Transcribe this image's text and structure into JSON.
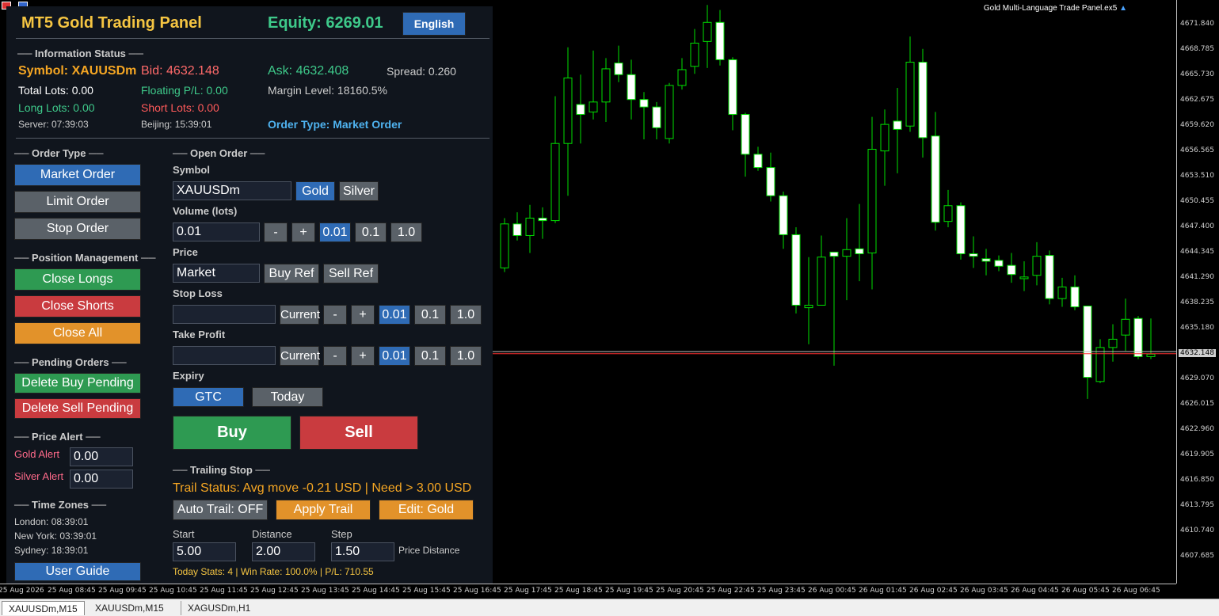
{
  "window": {
    "chart_title": "Gold Multi-Language Trade Panel.ex5",
    "tabs": [
      "XAUUSDm,M15",
      "XAUUSDm,M15",
      "XAGUSDm,H1"
    ],
    "active_tab": 0
  },
  "colors": {
    "bull_candle": "#00e000",
    "bear_candle_fill": "#ffffff",
    "bid_line": "#ff3030",
    "ask_line": "#c0c0c0",
    "panel_bg": "#10151d",
    "title_gold": "#f5c542",
    "equity_green": "#3ec98a"
  },
  "price_axis": {
    "labels": [
      "4671.840",
      "4668.785",
      "4665.730",
      "4662.675",
      "4659.620",
      "4656.565",
      "4653.510",
      "4650.455",
      "4647.400",
      "4644.345",
      "4641.290",
      "4638.235",
      "4635.180",
      "4629.070",
      "4626.015",
      "4622.960",
      "4619.905",
      "4616.850",
      "4613.795",
      "4610.740",
      "4607.685"
    ],
    "current_price_label": "4632.148"
  },
  "time_axis": {
    "labels": [
      "25 Aug 2026",
      "25 Aug 08:45",
      "25 Aug 09:45",
      "25 Aug 10:45",
      "25 Aug 11:45",
      "25 Aug 12:45",
      "25 Aug 13:45",
      "25 Aug 14:45",
      "25 Aug 15:45",
      "25 Aug 16:45",
      "25 Aug 17:45",
      "25 Aug 18:45",
      "25 Aug 19:45",
      "25 Aug 20:45",
      "25 Aug 22:45",
      "25 Aug 23:45",
      "26 Aug 00:45",
      "26 Aug 01:45",
      "26 Aug 02:45",
      "26 Aug 03:45",
      "26 Aug 04:45",
      "26 Aug 05:45",
      "26 Aug 06:45"
    ]
  },
  "candles": [
    [
      4642.5,
      4647.8,
      4642.0,
      4648.5
    ],
    [
      4647.8,
      4646.4,
      4645.8,
      4649.2
    ],
    [
      4646.4,
      4648.5,
      4644.3,
      4650.1
    ],
    [
      4648.5,
      4648.2,
      4646.0,
      4649.8
    ],
    [
      4648.2,
      4657.5,
      4647.9,
      4663.2
    ],
    [
      4657.5,
      4665.4,
      4651.2,
      4669.1
    ],
    [
      4662.2,
      4661.0,
      4657.5,
      4665.8
    ],
    [
      4661.3,
      4662.5,
      4660.4,
      4668.7
    ],
    [
      4662.5,
      4666.5,
      4660.1,
      4667.8
    ],
    [
      4667.2,
      4665.8,
      4664.9,
      4669.3
    ],
    [
      4665.8,
      4662.8,
      4660.4,
      4667.6
    ],
    [
      4662.8,
      4661.9,
      4658.0,
      4663.7
    ],
    [
      4661.9,
      4659.4,
      4658.0,
      4662.5
    ],
    [
      4658.1,
      4664.5,
      4657.5,
      4664.8
    ],
    [
      4664.5,
      4666.4,
      4664.0,
      4667.8
    ],
    [
      4666.8,
      4669.6,
      4665.9,
      4671.3
    ],
    [
      4669.8,
      4672.1,
      4666.6,
      4674.2
    ],
    [
      4672.1,
      4667.6,
      4666.9,
      4673.6
    ],
    [
      4667.6,
      4661.0,
      4659.1,
      4667.9
    ],
    [
      4661.0,
      4656.2,
      4653.5,
      4661.2
    ],
    [
      4656.2,
      4654.6,
      4654.2,
      4657.1
    ],
    [
      4654.6,
      4651.2,
      4650.5,
      4656.4
    ],
    [
      4651.2,
      4646.5,
      4644.8,
      4651.7
    ],
    [
      4646.5,
      4638.0,
      4637.0,
      4647.4
    ],
    [
      4637.7,
      4638.0,
      4633.3,
      4643.8
    ],
    [
      4638.0,
      4643.8,
      4638.0,
      4646.4
    ],
    [
      4644.4,
      4643.9,
      4630.7,
      4644.4
    ],
    [
      4643.9,
      4644.7,
      4638.6,
      4648.5
    ],
    [
      4644.8,
      4644.2,
      4640.9,
      4650.2
    ],
    [
      4644.3,
      4656.8,
      4639.9,
      4660.7
    ],
    [
      4656.6,
      4659.8,
      4652.4,
      4661.6
    ],
    [
      4660.2,
      4659.2,
      4653.9,
      4664.2
    ],
    [
      4659.6,
      4667.3,
      4658.9,
      4670.4
    ],
    [
      4667.3,
      4658.2,
      4655.8,
      4668.9
    ],
    [
      4658.4,
      4648.0,
      4647.0,
      4661.3
    ],
    [
      4648.1,
      4650.0,
      4647.4,
      4651.9
    ],
    [
      4650.0,
      4644.2,
      4643.5,
      4650.4
    ],
    [
      4644.2,
      4643.9,
      4642.5,
      4646.3
    ],
    [
      4643.6,
      4643.3,
      4641.6,
      4644.8
    ],
    [
      4643.4,
      4642.7,
      4642.1,
      4644.0
    ],
    [
      4642.8,
      4641.7,
      4640.7,
      4644.3
    ],
    [
      4641.2,
      4641.4,
      4639.7,
      4643.3
    ],
    [
      4641.6,
      4643.9,
      4640.4,
      4645.6
    ],
    [
      4644.0,
      4638.8,
      4638.1,
      4644.6
    ],
    [
      4638.8,
      4640.2,
      4637.8,
      4641.3
    ],
    [
      4640.2,
      4637.8,
      4637.4,
      4641.6
    ],
    [
      4637.9,
      4629.3,
      4626.7,
      4637.6
    ],
    [
      4628.8,
      4632.9,
      4628.6,
      4633.9
    ],
    [
      4632.9,
      4633.9,
      4631.2,
      4635.7
    ],
    [
      4634.4,
      4636.3,
      4632.5,
      4638.8
    ],
    [
      4636.4,
      4631.8,
      4631.5,
      4636.7
    ],
    [
      4631.8,
      4632.1,
      4631.5,
      4636.4
    ]
  ],
  "panel": {
    "title": "MT5 Gold Trading Panel",
    "equity": "Equity: 6269.01",
    "language_button": "English",
    "info_status_header": "── Information Status ──",
    "symbol": "Symbol: XAUUSDm",
    "bid": "Bid: 4632.148",
    "ask": "Ask: 4632.408",
    "spread": "Spread: 0.260",
    "total_lots": "Total Lots: 0.00",
    "floating_pl": "Floating P/L: 0.00",
    "margin_level": "Margin Level: 18160.5%",
    "long_lots": "Long Lots: 0.00",
    "short_lots": "Short Lots: 0.00",
    "server_time": "Server: 07:39:03",
    "beijing_time": "Beijing: 15:39:01",
    "order_type_status": "Order Type: Market Order",
    "order_type_header": "── Order Type ──",
    "market_order": "Market Order",
    "limit_order": "Limit Order",
    "stop_order": "Stop Order",
    "position_mgmt_header": "── Position Management ──",
    "close_longs": "Close Longs",
    "close_shorts": "Close Shorts",
    "close_all": "Close All",
    "pending_header": "── Pending Orders ──",
    "delete_buy_pending": "Delete Buy Pending",
    "delete_sell_pending": "Delete Sell Pending",
    "price_alert_header": "── Price Alert ──",
    "gold_alert_label": "Gold Alert",
    "gold_alert_value": "0.00",
    "silver_alert_label": "Silver Alert",
    "silver_alert_value": "0.00",
    "time_zones_header": "── Time Zones ──",
    "london": "London: 08:39:01",
    "new_york": "New York: 03:39:01",
    "sydney": "Sydney: 18:39:01",
    "user_guide": "User Guide",
    "open_order_header": "── Open Order ──",
    "symbol_label": "Symbol",
    "symbol_value": "XAUUSDm",
    "gold_btn": "Gold",
    "silver_btn": "Silver",
    "volume_label": "Volume (lots)",
    "volume_value": "0.01",
    "minus": "-",
    "plus": "+",
    "step_001": "0.01",
    "step_01": "0.1",
    "step_10": "1.0",
    "price_label": "Price",
    "price_value": "Market",
    "buy_ref": "Buy Ref",
    "sell_ref": "Sell Ref",
    "sl_label": "Stop Loss",
    "sl_value": "",
    "tp_label": "Take Profit",
    "tp_value": "",
    "current_btn": "Current",
    "expiry_label": "Expiry",
    "gtc": "GTC",
    "today": "Today",
    "buy": "Buy",
    "sell": "Sell",
    "trailing_header": "── Trailing Stop ──",
    "trail_status": "Trail Status: Avg move -0.21 USD | Need > 3.00 USD",
    "auto_trail": "Auto Trail: OFF",
    "apply_trail": "Apply Trail",
    "edit_gold": "Edit: Gold",
    "start_label": "Start",
    "start_value": "5.00",
    "distance_label": "Distance",
    "distance_value": "2.00",
    "step_label": "Step",
    "step_value": "1.50",
    "price_distance": "Price Distance",
    "today_stats": "Today Stats: 4 | Win Rate: 100.0% | P/L: 710.55"
  }
}
